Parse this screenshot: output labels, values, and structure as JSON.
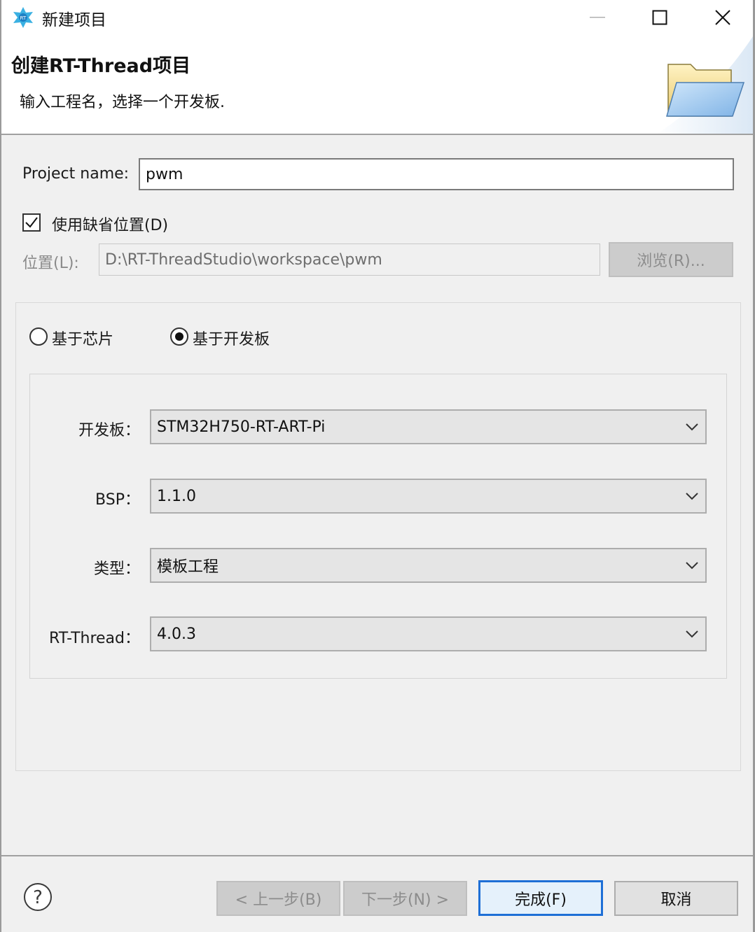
{
  "window": {
    "title": "新建项目",
    "controls": {
      "minimize": "minimize-icon",
      "maximize": "maximize-icon",
      "close": "close-icon"
    }
  },
  "banner": {
    "title": "创建RT-Thread项目",
    "description": "输入工程名，选择一个开发板.",
    "icon": "folder-open-icon"
  },
  "form": {
    "project_name_label": "Project name:",
    "project_name_value": "pwm",
    "use_default_label": "使用缺省位置(D)",
    "use_default_checked": true,
    "location_label": "位置(L):",
    "location_value": "D:\\RT-ThreadStudio\\workspace\\pwm",
    "browse_label": "浏览(R)..."
  },
  "mode": {
    "chip_label": "基于芯片",
    "board_label": "基于开发板",
    "selected": "board"
  },
  "board_settings": {
    "board_label": "开发板：",
    "board_value": "STM32H750-RT-ART-Pi",
    "bsp_label": "BSP：",
    "bsp_value": "1.1.0",
    "type_label": "类型：",
    "type_value": "模板工程",
    "rtthread_label": "RT-Thread：",
    "rtthread_value": "4.0.3"
  },
  "footer": {
    "help_icon": "help-icon",
    "back_label": "< 上一步(B)",
    "next_label": "下一步(N) >",
    "finish_label": "完成(F)",
    "cancel_label": "取消"
  },
  "colors": {
    "accent": "#1e6fd6",
    "window_bg": "#f0f0f0",
    "disabled_text": "#8c8c8c"
  }
}
